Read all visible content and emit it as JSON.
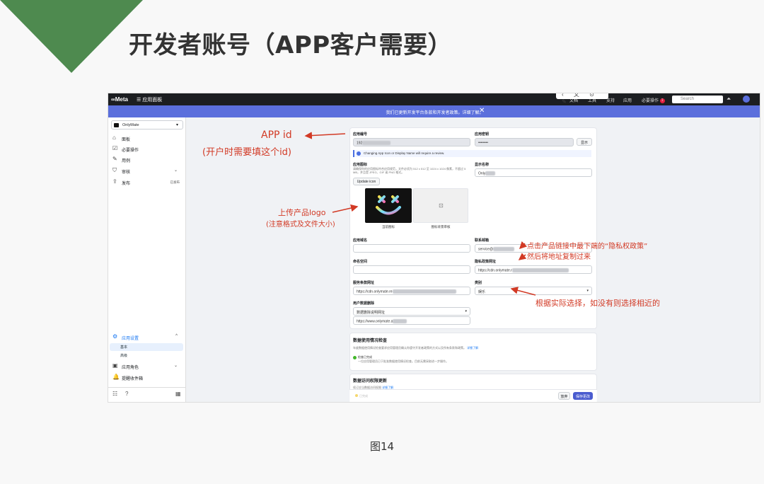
{
  "slide_title": "开发者账号（APP客户需要）",
  "figure_caption": "图14",
  "colors": {
    "corner": "#4e8a4f",
    "banner": "#5b6fdc",
    "annotation": "#d23a25",
    "primary_button": "#4a5ccf"
  },
  "topbar": {
    "brand": "∞Meta",
    "menu": "☰  应用面板",
    "nav": [
      "文档",
      "工具",
      "支持",
      "应用",
      "必要操作"
    ],
    "badge": "1",
    "search_placeholder": "Search",
    "floating_icons": "‹ 文 ⊙ ✎"
  },
  "banner": {
    "text": "我们已更新开发平台条款和开发者政策。详细了解。",
    "close": "✕"
  },
  "sidebar": {
    "app_name": "OnlyMate",
    "items": [
      {
        "icon": "⌂",
        "label": "面板"
      },
      {
        "icon": "☑",
        "label": "必要操作"
      },
      {
        "icon": "✎",
        "label": "用例"
      },
      {
        "icon": "⛉",
        "label": "审核",
        "chevron": "⌄"
      },
      {
        "icon": "⇪",
        "label": "发布",
        "tag": "已发布"
      }
    ],
    "settings": {
      "icon": "⚙",
      "label": "应用设置",
      "chevron": "^"
    },
    "settings_sub": [
      "基本",
      "高级"
    ],
    "roles": {
      "icon": "▣",
      "label": "应用角色",
      "chevron": "⌄"
    },
    "alerts": {
      "icon": "🔔",
      "label": "提醒收件箱"
    },
    "bottom_icons": [
      "☷",
      "?",
      "▦"
    ]
  },
  "form": {
    "app_id_label": "应用编号",
    "app_id_value": "192",
    "app_secret_label": "应用密钥",
    "app_secret_value": "••••••••",
    "show_button": "显示",
    "notice": "Changing App Icon or Display Name will require a review.",
    "app_icon_label": "应用图标",
    "app_icon_desc": "请确保你的应用图标符合应用规范，文件必须为 512 x 512 至 1024 x 1024 像素，不超过 5 MB，并且是 JPEG、GIF 或 PNG 格式。",
    "update_icon_button": "Update icon",
    "current_icon_caption": "当前图标",
    "icon_bg_caption": "图标背景审核",
    "display_name_label": "显示名称",
    "display_name_value": "Only",
    "app_domain_label": "应用域名",
    "contact_email_label": "联系邮箱",
    "contact_email_value": "service@",
    "namespace_label": "命名空间",
    "privacy_label": "隐私政策网址",
    "privacy_value": "https://cdn.onlymate.r",
    "terms_label": "服务条款网址",
    "terms_value": "https://cdn.onlymate.re",
    "category_label": "类别",
    "category_value": "娱乐",
    "deletion_label": "用户数据删除",
    "deletion_select": "数据删除说明网址",
    "deletion_value": "https://www.onlymate.a"
  },
  "data_use": {
    "title": "数据使用情况检查",
    "desc": "年度数据使用情况检查要求应用管理员确认你遵守开发者政策的方式以及所有条款和政策。",
    "link": "详细了解",
    "status": "检查已完成",
    "status_desc": "一位应用管理员已于批准数据使用情况检查。目前无需采取进一步操作。"
  },
  "access": {
    "title": "数据访问权限更新",
    "desc": "续订应当数据访问权限",
    "link": "详细了解",
    "status": "已完成"
  },
  "footer": {
    "discard_button": "放弃",
    "save_button": "保存更改"
  },
  "annotations": {
    "app_id": "APP id",
    "app_id_note": "(开户时需要填这个id)",
    "logo": "上传产品logo",
    "logo_note": "(注意格式及文件大小)",
    "privacy_note_1": "点击产品链接中最下端的“隐私权政策”",
    "privacy_note_2": "然后将地址复制过来",
    "category_note": "根据实际选择，如没有则选择相近的"
  }
}
